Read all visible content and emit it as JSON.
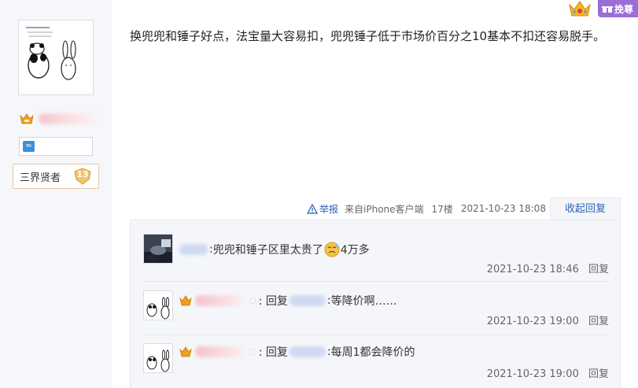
{
  "sidebar": {
    "level_title": "三界贤者",
    "level_number": "13"
  },
  "header": {
    "swap_label": "挽尊"
  },
  "post": {
    "content": "换兜兜和锤子好点，法宝量大容易扣，兜兜锤子低于市场价百分之10基本不扣还容易脱手。",
    "report_label": "举报",
    "source": "来自iPhone客户端",
    "floor": "17楼",
    "time": "2021-10-23 18:08",
    "collapse_label": "收起回复"
  },
  "replies": [
    {
      "separator": ":",
      "text_before": " 兜兜和锤子区里太贵了",
      "text_after": "4万多",
      "time": "2021-10-23 18:46",
      "reply_label": "回复"
    },
    {
      "prefix": ": 回复",
      "colon": ":",
      "text": "等降价啊……",
      "time": "2021-10-23 19:00",
      "reply_label": "回复"
    },
    {
      "prefix": ": 回复",
      "colon": ":",
      "text": "每周1都会降价的",
      "time": "2021-10-23 19:00",
      "reply_label": "回复"
    }
  ],
  "colors": {
    "link": "#2d64b3",
    "sidebar_bg": "#f5f7fa",
    "reply_bg": "#f5f6f9",
    "swap_bg": "#9b6dd6"
  }
}
